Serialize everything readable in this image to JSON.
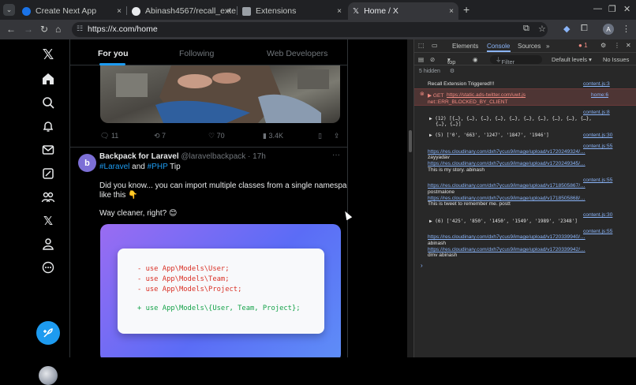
{
  "browser": {
    "tabs": [
      {
        "title": "Create Next App",
        "color": "#8ab4f8",
        "active": false
      },
      {
        "title": "Abinash4567/recall_exte",
        "color": "#e8eaed",
        "active": false
      },
      {
        "title": "Extensions",
        "color": "#c4c7c5",
        "active": false
      },
      {
        "title": "Home / X",
        "color": "#e8eaed",
        "active": true
      }
    ],
    "tab_close": "×",
    "new_tab": "+",
    "url": "https://x.com/home",
    "profile_initial": "A"
  },
  "feed": {
    "tabs": [
      "For you",
      "Following",
      "Web Developers"
    ],
    "post1_stats": {
      "replies": "11",
      "reposts": "7",
      "likes": "70",
      "views": "3.4K"
    },
    "post2": {
      "avatar_letter": "b",
      "author": "Backpack for Laravel",
      "handle": "@laravelbackpack",
      "time": "· 17h",
      "more": "···",
      "tag1": "#Laravel",
      "and": " and ",
      "tag2": "#PHP",
      "tip": " Tip",
      "line1": "Did you know... you can import multiple classes from a single namespace",
      "line2": "like this 👇",
      "line3": "Way cleaner, right? 😊",
      "code": [
        {
          "text": "- use App\\Models\\User;",
          "kind": "removed"
        },
        {
          "text": "- use App\\Models\\Team;",
          "kind": "removed"
        },
        {
          "text": "- use App\\Models\\Project;",
          "kind": "removed"
        },
        {
          "text": "+ use App\\Models\\{User, Team, Project};",
          "kind": "added"
        }
      ]
    }
  },
  "devtools": {
    "tabs": [
      "Elements",
      "Console",
      "Sources"
    ],
    "more_tabs": "»",
    "error_count": "1",
    "context": "top",
    "filter_placeholder": "Filter",
    "levels": "Default levels ▾",
    "issues": "No Issues",
    "hidden": "5 hidden",
    "logs": {
      "msg1": "Recall Extension Triggered!!!",
      "src1": "content.js:3",
      "err_prefix": "▶ GET ",
      "err_url": "https://static.ads-twitter.com/uwt.js",
      "err_src": "home:6",
      "err_msg": "net::ERR_BLOCKED_BY_CLIENT",
      "src2": "content.js:8",
      "arr1a": "▶ (12) [{…}, {…}, {…}, {…}, {…}, {…}, {…}, {…}, {…}, {…},",
      "arr1b": "{…}, {…}]",
      "arr2": "▶ (5) ['0', '663', '1247', '1847', '1946']",
      "src3": "content.js:30",
      "src4": "content.js:55",
      "link1": "https://res.cloudinary.com/dxh7ycus9/image/upload/v1720249324/…",
      "u1": "zayyadav",
      "link2": "https://res.cloudinary.com/dxh7ycus9/image/upload/v1720249345/…",
      "t1": "This is my story. abinash",
      "src5": "content.js:55",
      "link3": "https://res.cloudinary.com/dxh7ycus9/image/upload/v1718505867/…",
      "u2": "postmalone",
      "link4": "https://res.cloudinary.com/dxh7ycus9/image/upload/v1718505868/…",
      "t2": "This is tweet to remember me. postt",
      "src6": "content.js:30",
      "arr3": "▶ (6) ['425', '850', '1450', '1549', '1989', '2348']",
      "src7": "content.js:55",
      "link5": "https://res.cloudinary.com/dxh7ycus9/image/upload/v1720339940/…",
      "u3": "abinash",
      "link6": "https://res.cloudinary.com/dxh7ycus9/image/upload/v1720339942/…",
      "t3": "dmv abinash",
      "prompt": "›"
    }
  }
}
